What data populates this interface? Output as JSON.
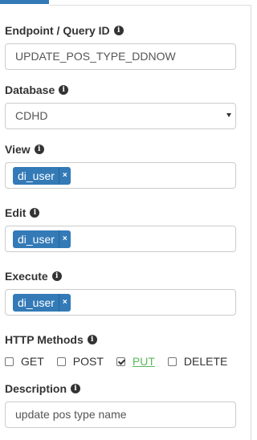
{
  "form": {
    "endpoint": {
      "label": "Endpoint / Query ID",
      "value": "UPDATE_POS_TYPE_DDNOW"
    },
    "database": {
      "label": "Database",
      "value": "CDHD"
    },
    "view": {
      "label": "View",
      "tags": [
        {
          "text": "di_user",
          "remove": "×"
        }
      ]
    },
    "edit": {
      "label": "Edit",
      "tags": [
        {
          "text": "di_user",
          "remove": "×"
        }
      ]
    },
    "execute": {
      "label": "Execute",
      "tags": [
        {
          "text": "di_user",
          "remove": "×"
        }
      ]
    },
    "http_methods": {
      "label": "HTTP Methods",
      "options": [
        {
          "label": "GET",
          "checked": false
        },
        {
          "label": "POST",
          "checked": false
        },
        {
          "label": "PUT",
          "checked": true
        },
        {
          "label": "DELETE",
          "checked": false
        }
      ]
    },
    "description": {
      "label": "Description",
      "value": "update pos type name"
    }
  },
  "icons": {
    "info": "i"
  },
  "colors": {
    "primary": "#337ab7",
    "active_method": "#5cb85c",
    "border": "#cccccc"
  }
}
